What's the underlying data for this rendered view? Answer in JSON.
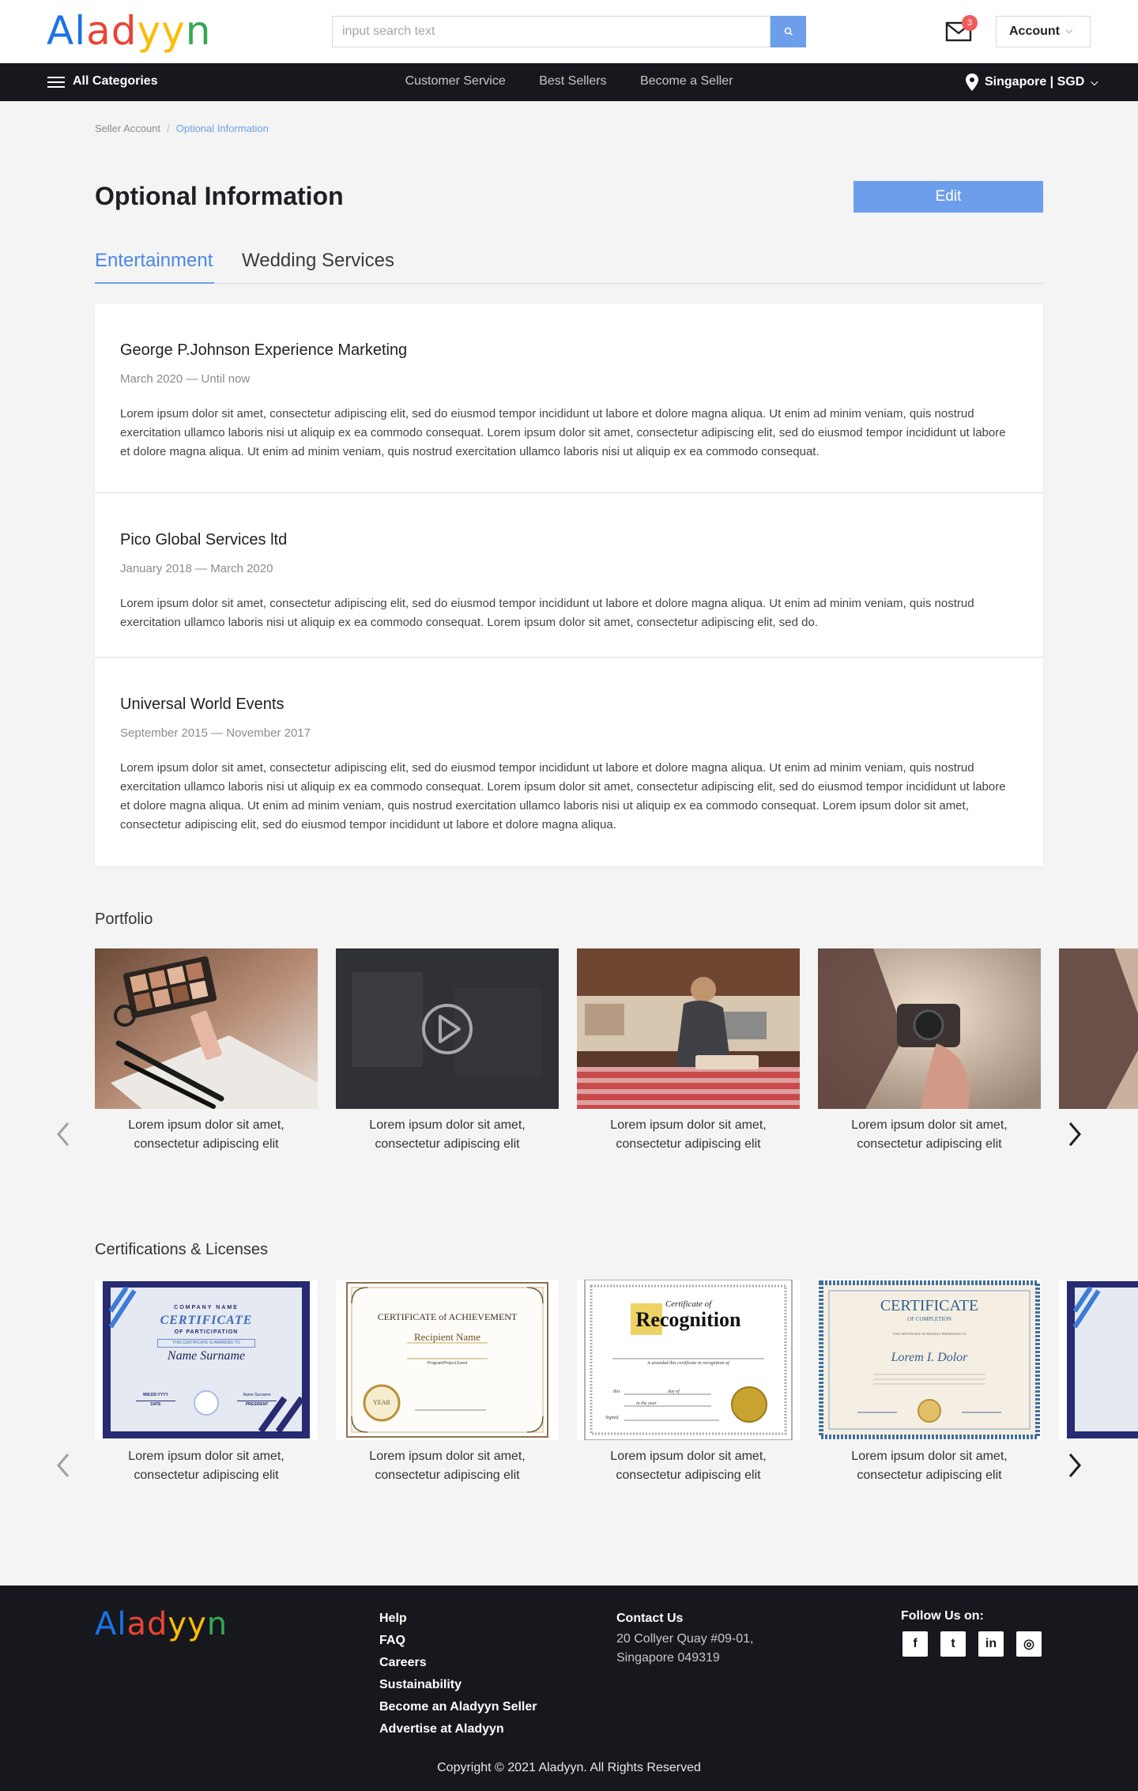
{
  "header": {
    "logo": [
      {
        "ch": "A",
        "color": "#1a73e8"
      },
      {
        "ch": "l",
        "color": "#1a73e8"
      },
      {
        "ch": "a",
        "color": "#ea4335"
      },
      {
        "ch": "d",
        "color": "#ea4335"
      },
      {
        "ch": "y",
        "color": "#fbbc05"
      },
      {
        "ch": "y",
        "color": "#fbbc05"
      },
      {
        "ch": "n",
        "color": "#34a853"
      }
    ],
    "search_placeholder": "input search text",
    "mail_badge": "3",
    "account_label": "Account"
  },
  "nav": {
    "all_categories": "All Categories",
    "links": [
      "Customer Service",
      "Best Sellers",
      "Become a Seller"
    ],
    "location": "Singapore | SGD"
  },
  "breadcrumb": {
    "parent": "Seller Account",
    "current": "Optional Information"
  },
  "page": {
    "title": "Optional Information",
    "edit_label": "Edit"
  },
  "tabs": [
    {
      "label": "Entertainment",
      "active": true
    },
    {
      "label": "Wedding Services",
      "active": false
    }
  ],
  "experiences": [
    {
      "company": "George P.Johnson Experience Marketing",
      "dates": "March 2020 — Until now",
      "description": "Lorem ipsum dolor sit amet, consectetur adipiscing elit, sed do eiusmod tempor incididunt ut labore et dolore magna aliqua. Ut enim ad minim veniam, quis nostrud exercitation ullamco laboris nisi ut aliquip ex ea commodo consequat. Lorem ipsum dolor sit amet, consectetur adipiscing elit, sed do eiusmod tempor incididunt ut labore et dolore magna aliqua. Ut enim ad minim veniam, quis nostrud exercitation ullamco laboris nisi ut aliquip ex ea commodo consequat."
    },
    {
      "company": "Pico Global Services ltd",
      "dates": "January 2018 — March 2020",
      "description": "Lorem ipsum dolor sit amet, consectetur adipiscing elit, sed do eiusmod tempor incididunt ut labore et dolore magna aliqua. Ut enim ad minim veniam, quis nostrud exercitation ullamco laboris nisi ut aliquip ex ea commodo consequat. Lorem ipsum dolor sit amet, consectetur adipiscing elit, sed do."
    },
    {
      "company": "Universal World Events",
      "dates": "September 2015 — November 2017",
      "description": "Lorem ipsum dolor sit amet, consectetur adipiscing elit, sed do eiusmod tempor incididunt ut labore et dolore magna aliqua. Ut enim ad minim veniam, quis nostrud exercitation ullamco laboris nisi ut aliquip ex ea commodo consequat. Lorem ipsum dolor sit amet, consectetur adipiscing elit, sed do eiusmod tempor incididunt ut labore et dolore magna aliqua. Ut enim ad minim veniam, quis nostrud exercitation ullamco laboris nisi ut aliquip ex ea commodo consequat. Lorem ipsum dolor sit amet, consectetur adipiscing elit, sed do eiusmod tempor incididunt ut labore et dolore magna aliqua."
    }
  ],
  "portfolio": {
    "title": "Portfolio",
    "items": [
      {
        "kind": "makeup-photo",
        "caption_1": "Lorem ipsum dolor sit amet,",
        "caption_2": "consectetur adipiscing elit"
      },
      {
        "kind": "video",
        "caption_1": "Lorem ipsum dolor sit amet,",
        "caption_2": "consectetur adipiscing elit"
      },
      {
        "kind": "kitchen-photo",
        "caption_1": "Lorem ipsum dolor sit amet,",
        "caption_2": "consectetur adipiscing elit"
      },
      {
        "kind": "camera-photo",
        "caption_1": "Lorem ipsum dolor sit amet,",
        "caption_2": "consectetur adipiscing elit"
      },
      {
        "kind": "camera-photo",
        "caption_1": "",
        "caption_2": ""
      }
    ]
  },
  "certifications": {
    "title": "Certifications & Licenses",
    "items": [
      {
        "caption_1": "Lorem ipsum dolor sit amet,",
        "caption_2": "consectetur adipiscing elit",
        "c1_company": "COMPANY NAME",
        "c1_title": "CERTIFICATE",
        "c1_sub": "OF PARTICIPATION",
        "c1_awarded": "THIS CERTIFICATE IS AWARDED TO",
        "c1_name": "Name Surname",
        "c1_date_val": "MM.DD.YYYY",
        "c1_date": "DATE",
        "c1_sig_name": "Name Surname",
        "c1_president": "PRESIDENT"
      },
      {
        "caption_1": "Lorem ipsum dolor sit amet,",
        "caption_2": "consectetur adipiscing elit",
        "c2_title": "CERTIFICATE of ACHIEVEMENT",
        "c2_name": "Recipient Name",
        "c2_event": "Program/Project Event",
        "c2_seal": "YEAR"
      },
      {
        "caption_1": "Lorem ipsum dolor sit amet,",
        "caption_2": "consectetur adipiscing elit",
        "c3_top": "Certificate of",
        "c3_title": "Recognition",
        "c3_line": "is awarded this certificate in recognition of",
        "c3_this": "this",
        "c3_day": "day of",
        "c3_year": "in the year",
        "c3_signed": "Signed"
      },
      {
        "caption_1": "Lorem ipsum dolor sit amet,",
        "caption_2": "consectetur adipiscing elit",
        "c4_title": "CERTIFICATE",
        "c4_sub": "OF COMPLETION",
        "c4_line": "THIS CERTIFICATE IS PROUDLY PRESENTED TO",
        "c4_name": "Lorem I. Dolor"
      },
      {
        "caption_1": "",
        "caption_2": ""
      }
    ]
  },
  "footer": {
    "logo": [
      {
        "ch": "A",
        "color": "#1a73e8"
      },
      {
        "ch": "l",
        "color": "#1a73e8"
      },
      {
        "ch": "a",
        "color": "#ea4335"
      },
      {
        "ch": "d",
        "color": "#ea4335"
      },
      {
        "ch": "y",
        "color": "#fbbc05"
      },
      {
        "ch": "y",
        "color": "#fbbc05"
      },
      {
        "ch": "n",
        "color": "#34a853"
      }
    ],
    "links": [
      "Help",
      "FAQ",
      "Careers",
      "Sustainability",
      "Become an Aladyyn Seller",
      "Advertise at Aladyyn"
    ],
    "contact_title": "Contact Us",
    "address_1": "20 Collyer Quay #09-01,",
    "address_2": "Singapore 049319",
    "follow_title": "Follow Us on:",
    "socials": [
      {
        "name": "facebook-icon",
        "glyph": "f"
      },
      {
        "name": "twitter-icon",
        "glyph": "t"
      },
      {
        "name": "linkedin-icon",
        "glyph": "in"
      },
      {
        "name": "instagram-icon",
        "glyph": "◎"
      }
    ],
    "copyright": "Copyright © 2021 Aladyyn. All Rights Reserved"
  },
  "colors": {
    "accent": "#6d9eeb",
    "dark": "#16181d",
    "badge": "#ef5b5b"
  }
}
